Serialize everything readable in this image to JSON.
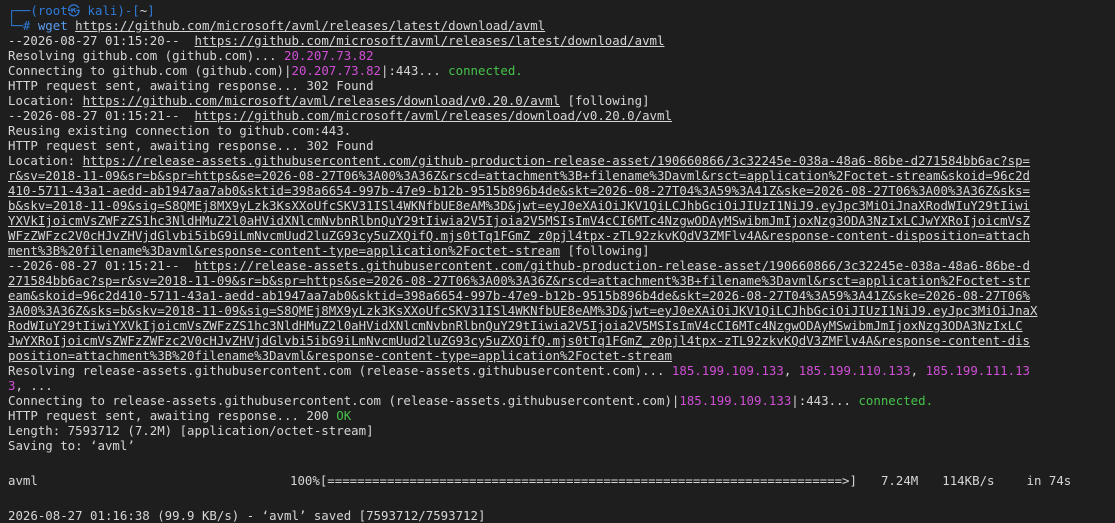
{
  "prompt": {
    "frame_open": "┌──(",
    "user_host": "root㉿ kali",
    "sep": ")-[",
    "path": "~",
    "frame_close": "]",
    "hash_prefix": "└─# ",
    "command": "wget ",
    "command_url": "https://github.com/microsoft/avml/releases/latest/download/avml"
  },
  "lines": {
    "l1_ts": "--2026-08-27 01:15:20--  ",
    "l1_url": "https://github.com/microsoft/avml/releases/latest/download/avml",
    "l2_text": "Resolving github.com (github.com)... ",
    "l2_ip": "20.207.73.82",
    "l3_text": "Connecting to github.com (github.com)|",
    "l3_ip": "20.207.73.82",
    "l3_port": "|:443... ",
    "l3_status": "connected.",
    "l4": "HTTP request sent, awaiting response... 302 Found",
    "l5_label": "Location: ",
    "l5_url": "https://github.com/microsoft/avml/releases/download/v0.20.0/avml",
    "l5_tail": " [following]",
    "l6_ts": "--2026-08-27 01:15:21--  ",
    "l6_url": "https://github.com/microsoft/avml/releases/download/v0.20.0/avml",
    "l7": "Reusing existing connection to github.com:443.",
    "l8": "HTTP request sent, awaiting response... 302 Found",
    "loc2_label": "Location: ",
    "loc2_url": [
      "https://release-assets.githubusercontent.com/github-production-release-asset/190660866/3c32245e-038a-48a6-86be-d271584bb6ac?sp=",
      "r&sv=2018-11-09&sr=b&spr=https&se=2026-08-27T06%3A00%3A36Z&rscd=attachment%3B+filename%3Davml&rsct=application%2Foctet-stream&skoid=96c2d",
      "410-5711-43a1-aedd-ab1947aa7ab0&sktid=398a6654-997b-47e9-b12b-9515b896b4de&skt=2026-08-27T04%3A59%3A41Z&ske=2026-08-27T06%3A00%3A36Z&sks=",
      "b&skv=2018-11-09&sig=S8QMEj8MX9yLzk3KsXXoUfcSKV31ISl4WKNfbUE8eAM%3D&jwt=eyJ0eXAiOiJKV1QiLCJhbGciOiJIUzI1NiJ9.eyJpc3MiOiJnaXRodWIuY29tIiwi",
      "YXVkIjoicmVsZWFzZS1hc3NldHMuZ2l0aHVidXNlcmNvbnRlbnQuY29tIiwia2V5Ijoia2V5MSIsImV4cCI6MTc4NzgwODAyMSwibmJmIjoxNzg3ODA3NzIxLCJwYXRoIjoicmVsZ",
      "WFzZWFzc2V0cHJvZHVjdGlvbi5ibG9iLmNvcmUud2luZG93cy5uZXQifQ.mjs0tTq1FGmZ_z0pjl4tpx-zTL92zkvKQdV3ZMFlv4A&response-content-disposition=attach",
      "ment%3B%20filename%3Davml&response-content-type=application%2Foctet-stream"
    ],
    "loc2_tail": " [following]",
    "l9_ts": "--2026-08-27 01:15:21--  ",
    "l9_url": [
      "https://release-assets.githubusercontent.com/github-production-release-asset/190660866/3c32245e-038a-48a6-86be-d",
      "271584bb6ac?sp=r&sv=2018-11-09&sr=b&spr=https&se=2026-08-27T06%3A00%3A36Z&rscd=attachment%3B+filename%3Davml&rsct=application%2Foctet-str",
      "eam&skoid=96c2d410-5711-43a1-aedd-ab1947aa7ab0&sktid=398a6654-997b-47e9-b12b-9515b896b4de&skt=2026-08-27T04%3A59%3A41Z&ske=2026-08-27T06%",
      "3A00%3A36Z&sks=b&skv=2018-11-09&sig=S8QMEj8MX9yLzk3KsXXoUfcSKV31ISl4WKNfbUE8eAM%3D&jwt=eyJ0eXAiOiJKV1QiLCJhbGciOiJIUzI1NiJ9.eyJpc3MiOiJnaX",
      "RodWIuY29tIiwiYXVkIjoicmVsZWFzZS1hc3NldHMuZ2l0aHVidXNlcmNvbnRlbnQuY29tIiwia2V5Ijoia2V5MSIsImV4cCI6MTc4NzgwODAyMSwibmJmIjoxNzg3ODA3NzIxLC",
      "JwYXRoIjoicmVsZWFzZWFzc2V0cHJvZHVjdGlvbi5ibG9iLmNvcmUud2luZG93cy5uZXQifQ.mjs0tTq1FGmZ_z0pjl4tpx-zTL92zkvKQdV3ZMFlv4A&response-content-dis",
      "position=attachment%3B%20filename%3Davml&response-content-type=application%2Foctet-stream"
    ],
    "resolve_text": "Resolving release-assets.githubusercontent.com (release-assets.githubusercontent.com)... ",
    "resolve_ip1": "185.199.109.133",
    "resolve_sep1": ", ",
    "resolve_ip2": "185.199.110.133",
    "resolve_sep2": ", ",
    "resolve_ip3a": "185.199.111.13",
    "resolve_ip3b": "3",
    "resolve_tail": ", ...",
    "conn2_text": "Connecting to release-assets.githubusercontent.com (release-assets.githubusercontent.com)|",
    "conn2_ip": "185.199.109.133",
    "conn2_port": "|:443... ",
    "conn2_status": "connected.",
    "http3_text": "HTTP request sent, awaiting response... 200 ",
    "http3_ok": "OK",
    "length": "Length: 7593712 (7.2M) [application/octet-stream]",
    "saving": "Saving to: ‘avml’"
  },
  "progress": {
    "filename": "avml",
    "percent": "100%",
    "percent_value": 100,
    "bar": "[=====================================================================>]",
    "size": "7.24M",
    "speed": "114KB/s",
    "eta": "in 74s"
  },
  "final": "2026-08-27 01:16:38 (99.9 KB/s) - ‘avml’ saved [7593712/7593712]"
}
